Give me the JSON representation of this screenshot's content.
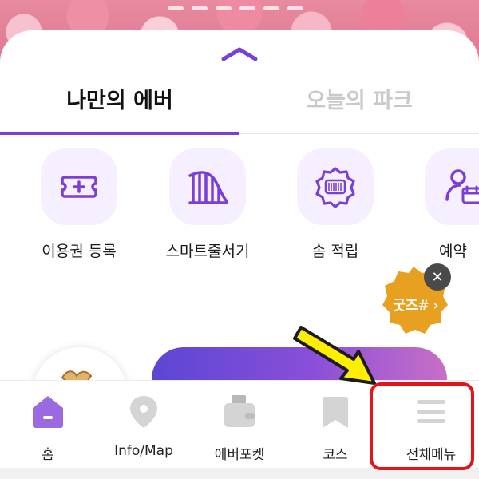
{
  "tabs": [
    {
      "label": "나만의 에버",
      "active": true
    },
    {
      "label": "오늘의 파크",
      "active": false
    }
  ],
  "quick_menu": [
    {
      "label": "이용권 등록",
      "icon": "ticket-plus-icon"
    },
    {
      "label": "스마트줄서기",
      "icon": "roller-coaster-icon"
    },
    {
      "label": "솜 적립",
      "icon": "barcode-badge-icon"
    },
    {
      "label": "예약",
      "icon": "person-calendar-icon"
    }
  ],
  "goods_badge": {
    "label": "굿즈#",
    "chevron": "›",
    "close": "✕"
  },
  "bottom_nav": [
    {
      "label": "홈",
      "icon": "home-icon"
    },
    {
      "label": "Info/Map",
      "icon": "map-pin-icon"
    },
    {
      "label": "에버포켓",
      "icon": "wallet-icon"
    },
    {
      "label": "코스",
      "icon": "bookmark-icon"
    },
    {
      "label": "전체메뉴",
      "icon": "hamburger-menu-icon"
    }
  ],
  "colors": {
    "accent": "#7b3fd6",
    "highlight": "#e3141c",
    "arrow": "#ffee00",
    "goods_badge": "#e8a020"
  }
}
